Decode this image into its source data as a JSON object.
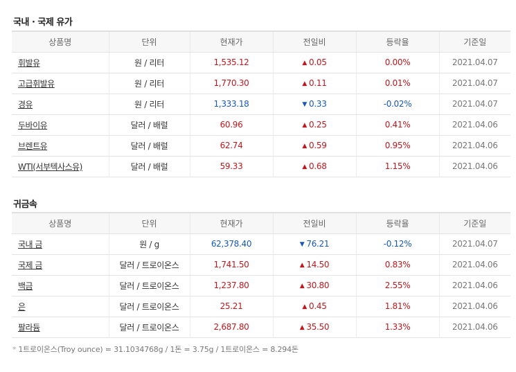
{
  "oil": {
    "title": "국내 · 국제 유가",
    "headers": [
      "상품명",
      "단위",
      "현재가",
      "전일비",
      "등락율",
      "기준일"
    ],
    "rows": [
      {
        "name": "휘발유",
        "unit": "원 / 리터",
        "price": "1,535.12",
        "direction": "up",
        "arrow": "▲",
        "change": "0.05",
        "rate": "0.00%",
        "date": "2021.04.07"
      },
      {
        "name": "고급휘발유",
        "unit": "원 / 리터",
        "price": "1,770.30",
        "direction": "up",
        "arrow": "▲",
        "change": "0.11",
        "rate": "0.01%",
        "date": "2021.04.07"
      },
      {
        "name": "경유",
        "unit": "원 / 리터",
        "price": "1,333.18",
        "direction": "down",
        "arrow": "▼",
        "change": "0.33",
        "rate": "-0.02%",
        "date": "2021.04.07"
      },
      {
        "name": "두바이유",
        "unit": "달러 / 배럴",
        "price": "60.96",
        "direction": "up",
        "arrow": "▲",
        "change": "0.25",
        "rate": "0.41%",
        "date": "2021.04.06"
      },
      {
        "name": "브렌트유",
        "unit": "달러 / 배럴",
        "price": "62.74",
        "direction": "up",
        "arrow": "▲",
        "change": "0.59",
        "rate": "0.95%",
        "date": "2021.04.06"
      },
      {
        "name": "WTI(서부텍사스유)",
        "unit": "달러 / 배럴",
        "price": "59.33",
        "direction": "up",
        "arrow": "▲",
        "change": "0.68",
        "rate": "1.15%",
        "date": "2021.04.06"
      }
    ]
  },
  "metal": {
    "title": "귀금속",
    "headers": [
      "상품명",
      "단위",
      "현재가",
      "전일비",
      "등락율",
      "기준일"
    ],
    "rows": [
      {
        "name": "국내 금",
        "unit": "원 / g",
        "price": "62,378.40",
        "direction": "down",
        "arrow": "▼",
        "change": "76.21",
        "rate": "-0.12%",
        "date": "2021.04.07"
      },
      {
        "name": "국제 금",
        "unit": "달러 / 트로이온스",
        "price": "1,741.50",
        "direction": "up",
        "arrow": "▲",
        "change": "14.50",
        "rate": "0.83%",
        "date": "2021.04.06"
      },
      {
        "name": "백금",
        "unit": "달러 / 트로이온스",
        "price": "1,237.80",
        "direction": "up",
        "arrow": "▲",
        "change": "30.80",
        "rate": "2.55%",
        "date": "2021.04.06"
      },
      {
        "name": "은",
        "unit": "달러 / 트로이온스",
        "price": "25.21",
        "direction": "up",
        "arrow": "▲",
        "change": "0.45",
        "rate": "1.81%",
        "date": "2021.04.06"
      },
      {
        "name": "팔라듐",
        "unit": "달러 / 트로이온스",
        "price": "2,687.80",
        "direction": "up",
        "arrow": "▲",
        "change": "35.50",
        "rate": "1.33%",
        "date": "2021.04.06"
      }
    ]
  },
  "footnote": {
    "bullet": "*",
    "text": "1트로이온스(Troy ounce) = 31.1034768g / 1돈 = 3.75g / 1트로이온스 = 8.294돈"
  },
  "colors": {
    "up": "#c0171c",
    "down": "#1657b8"
  }
}
